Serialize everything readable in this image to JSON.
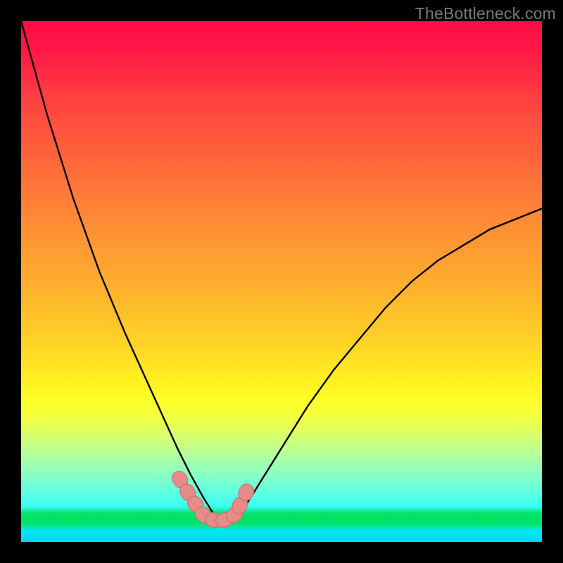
{
  "watermark": "TheBottleneck.com",
  "colors": {
    "frame": "#000000",
    "curve": "#000000",
    "marker_fill": "#e58b88",
    "marker_stroke": "#cf6f6d",
    "green_bar": "#00e060"
  },
  "chart_data": {
    "type": "line",
    "title": "",
    "xlabel": "",
    "ylabel": "",
    "xlim": [
      0,
      1
    ],
    "ylim": [
      0,
      1
    ],
    "grid": false,
    "optimum_band_y": 0.955,
    "x": [
      0.0,
      0.05,
      0.1,
      0.15,
      0.2,
      0.25,
      0.3,
      0.325,
      0.35,
      0.375,
      0.4,
      0.425,
      0.45,
      0.5,
      0.55,
      0.6,
      0.65,
      0.7,
      0.75,
      0.8,
      0.85,
      0.9,
      0.95,
      1.0
    ],
    "y": [
      0.0,
      0.18,
      0.34,
      0.48,
      0.6,
      0.71,
      0.82,
      0.87,
      0.915,
      0.955,
      0.955,
      0.94,
      0.9,
      0.82,
      0.74,
      0.67,
      0.61,
      0.55,
      0.5,
      0.46,
      0.43,
      0.4,
      0.38,
      0.36
    ],
    "markers": {
      "x": [
        0.305,
        0.32,
        0.335,
        0.35,
        0.37,
        0.39,
        0.41,
        0.42,
        0.432
      ],
      "y": [
        0.88,
        0.905,
        0.928,
        0.948,
        0.958,
        0.958,
        0.948,
        0.93,
        0.905
      ]
    }
  }
}
